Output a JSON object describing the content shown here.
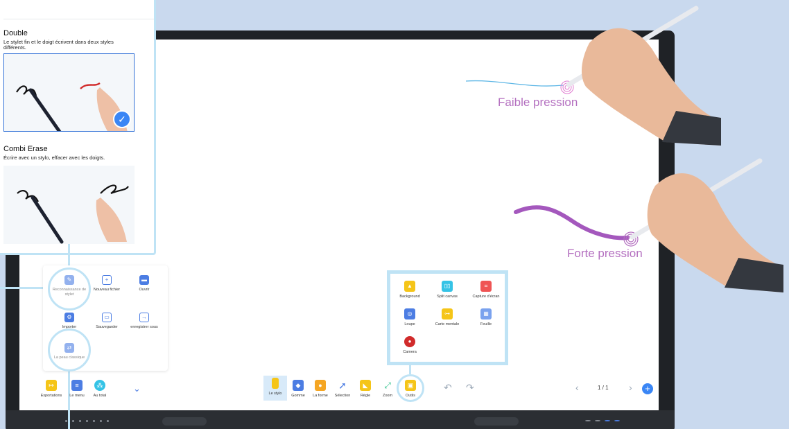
{
  "pen_options": {
    "double": {
      "title": "Double",
      "description": "Le stylet fin et le doigt écrivent dans deux styles différents."
    },
    "combi_erase": {
      "title": "Combi Erase",
      "description": "Écrire avec un stylo, effacer avec les doigts."
    }
  },
  "annotations": {
    "low_pressure": "Faible pression",
    "high_pressure": "Forte pression"
  },
  "menu": {
    "items": [
      {
        "label": "Reconnaissance de stylet",
        "icon": "pen-recognition-icon"
      },
      {
        "label": "Nouveau fichier",
        "icon": "new-file-icon"
      },
      {
        "label": "Ouvrir",
        "icon": "folder-icon"
      },
      {
        "label": "Importer",
        "icon": "import-icon"
      },
      {
        "label": "Sauvegarder",
        "icon": "save-icon"
      },
      {
        "label": "enregistrer sous",
        "icon": "save-as-icon"
      },
      {
        "label": "La peau classique",
        "icon": "skin-icon"
      }
    ]
  },
  "tools": {
    "items": [
      {
        "label": "Background",
        "icon": "background-icon"
      },
      {
        "label": "Split canvas",
        "icon": "split-canvas-icon"
      },
      {
        "label": "Capture d'écran",
        "icon": "screenshot-icon"
      },
      {
        "label": "Loupe",
        "icon": "magnifier-icon"
      },
      {
        "label": "Carte mentale",
        "icon": "mind-map-icon"
      },
      {
        "label": "Feuille",
        "icon": "sheet-icon"
      },
      {
        "label": "Camera",
        "icon": "camera-icon"
      }
    ]
  },
  "toolbar": {
    "left": [
      {
        "label": "Exportations",
        "icon": "export-icon"
      },
      {
        "label": "Le menu",
        "icon": "menu-icon"
      },
      {
        "label": "Au total",
        "icon": "share-icon"
      }
    ],
    "center": [
      {
        "label": "Le stylo",
        "icon": "pen-icon"
      },
      {
        "label": "Gomme",
        "icon": "eraser-icon"
      },
      {
        "label": "La forme",
        "icon": "shape-icon"
      },
      {
        "label": "Sélection",
        "icon": "selection-icon"
      },
      {
        "label": "Règle",
        "icon": "ruler-icon"
      },
      {
        "label": "Zoom",
        "icon": "zoom-icon"
      },
      {
        "label": "Outils",
        "icon": "toolbox-icon"
      }
    ],
    "page_indicator": "1 / 1"
  },
  "colors": {
    "accent": "#3a86f5",
    "halo": "#bfe3f5",
    "annotation": "#b470c0",
    "icon_blue": "#4c7de3",
    "icon_yellow": "#f5c518"
  }
}
